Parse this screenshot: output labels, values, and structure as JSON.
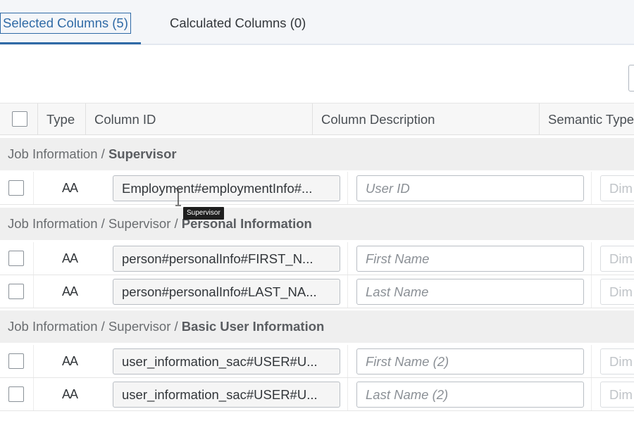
{
  "tabs": [
    {
      "label": "Selected Columns (5)",
      "active": true
    },
    {
      "label": "Calculated Columns (0)",
      "active": false
    }
  ],
  "table": {
    "headers": [
      "Type",
      "Column ID",
      "Column Description",
      "Semantic Type"
    ],
    "groups": [
      {
        "path": "Job Information / ",
        "bold": "Supervisor"
      },
      {
        "path": "Job Information / Supervisor / ",
        "bold": "Personal Information"
      },
      {
        "path": "Job Information / Supervisor / ",
        "bold": "Basic User Information"
      }
    ],
    "rows": [
      {
        "type_icon": "text-type-icon",
        "type_label": "AA",
        "column_id": "Employment#employmentInfo#...",
        "description_placeholder": "User ID",
        "semantic": "Dim"
      },
      {
        "type_icon": "text-type-icon",
        "type_label": "AA",
        "column_id": "person#personalInfo#FIRST_N...",
        "description_placeholder": "First Name",
        "semantic": "Dim"
      },
      {
        "type_icon": "text-type-icon",
        "type_label": "AA",
        "column_id": "person#personalInfo#LAST_NA...",
        "description_placeholder": "Last Name",
        "semantic": "Dim"
      },
      {
        "type_icon": "text-type-icon",
        "type_label": "AA",
        "column_id": "user_information_sac#USER#U...",
        "description_placeholder": "First Name (2)",
        "semantic": "Dim"
      },
      {
        "type_icon": "text-type-icon",
        "type_label": "AA",
        "column_id": "user_information_sac#USER#U...",
        "description_placeholder": "Last Name (2)",
        "semantic": "Dim"
      }
    ]
  },
  "tooltip": "Supervisor",
  "colors": {
    "accent": "#2f6aa6",
    "group_bg": "#efefef",
    "header_bg": "#f7f7f7"
  }
}
